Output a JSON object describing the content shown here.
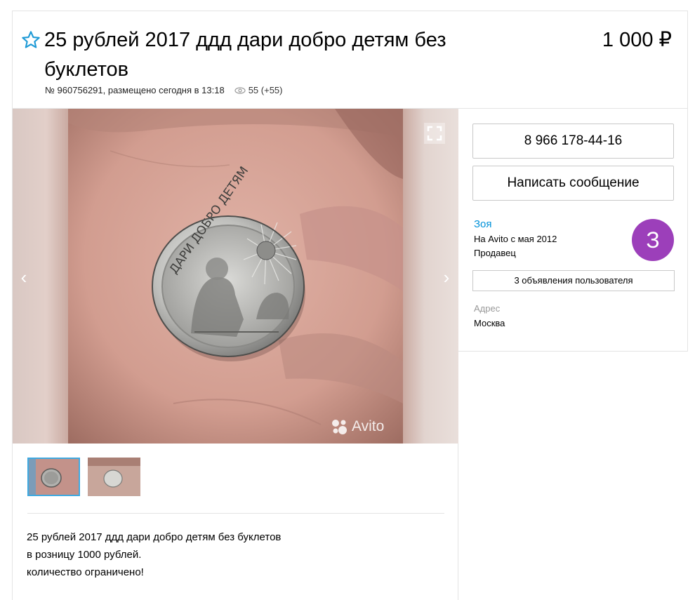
{
  "header": {
    "title": "25 рублей 2017 ддд дари добро детям без буклетов",
    "price": "1 000 ₽",
    "listing_meta": "№ 960756291, размещено сегодня в 13:18",
    "views": "55 (+55)"
  },
  "gallery": {
    "watermark": "Avito",
    "prev_icon": "‹",
    "next_icon": "›",
    "coin_inscription": "ДАРИ ДОБРО ДЕТЯМ",
    "thumbnails": [
      {
        "active": true
      },
      {
        "active": false
      }
    ]
  },
  "description": {
    "lines": [
      "25 рублей 2017 ддд дари добро детям без буклетов",
      "в розницу 1000 рублей.",
      "количество ограничено!"
    ]
  },
  "contact": {
    "phone": "8 966 178-44-16",
    "message_button": "Написать сообщение"
  },
  "seller": {
    "name": "Зоя",
    "since": "На Avito с мая 2012",
    "type": "Продавец",
    "avatar_letter": "З",
    "avatar_color": "#9c3fba",
    "listings_button": "3 объявления пользователя"
  },
  "address": {
    "label": "Адрес",
    "value": "Москва"
  },
  "colors": {
    "link": "#0091d9",
    "star": "#1e9ad6",
    "thumb_active_border": "#3fa9e0"
  }
}
